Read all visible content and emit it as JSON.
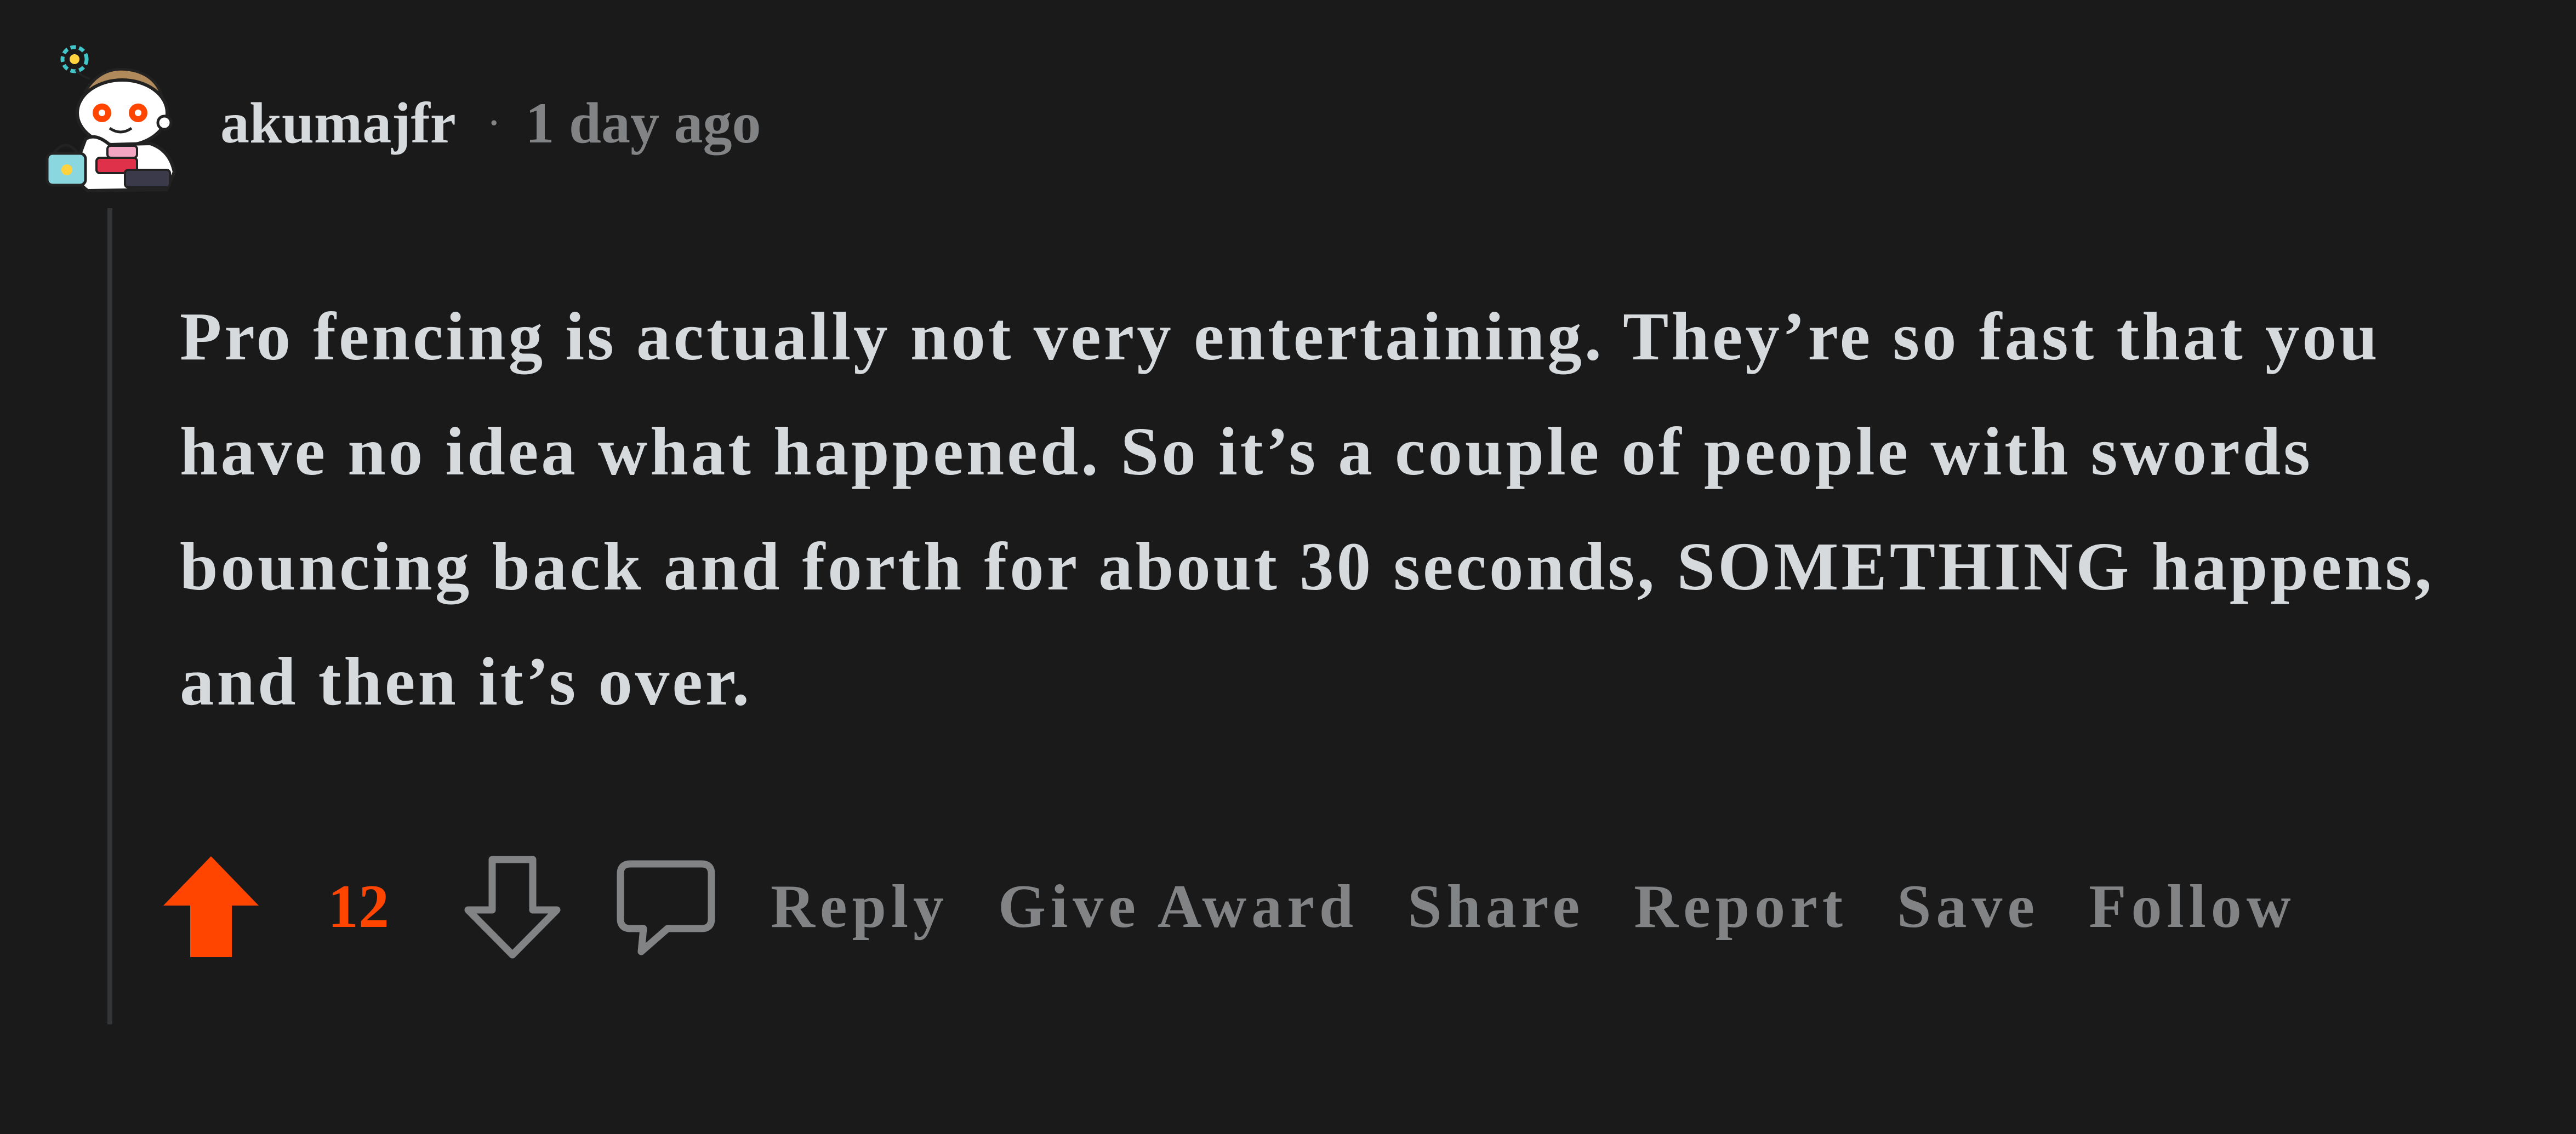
{
  "comment": {
    "username": "akumajfr",
    "separator": "·",
    "timestamp": "1 day ago",
    "body": "Pro fencing is actually not very entertaining. They’re so fast that you have no idea what happened. So it’s a couple of people with swords bouncing back and forth for about 30 seconds, SOMETHING happens, and then it’s over.",
    "score": "12",
    "vote_state": "upvoted"
  },
  "actions": {
    "reply": "Reply",
    "give_award": "Give Award",
    "share": "Share",
    "report": "Report",
    "save": "Save",
    "follow": "Follow"
  },
  "colors": {
    "background": "#1a1a1b",
    "upvote": "#ff4500",
    "text": "#d7dadc",
    "muted": "#818384"
  },
  "icons": {
    "avatar": "snoo-avatar",
    "upvote": "arrow-up-icon",
    "downvote": "arrow-down-icon",
    "reply": "speech-bubble-icon"
  }
}
